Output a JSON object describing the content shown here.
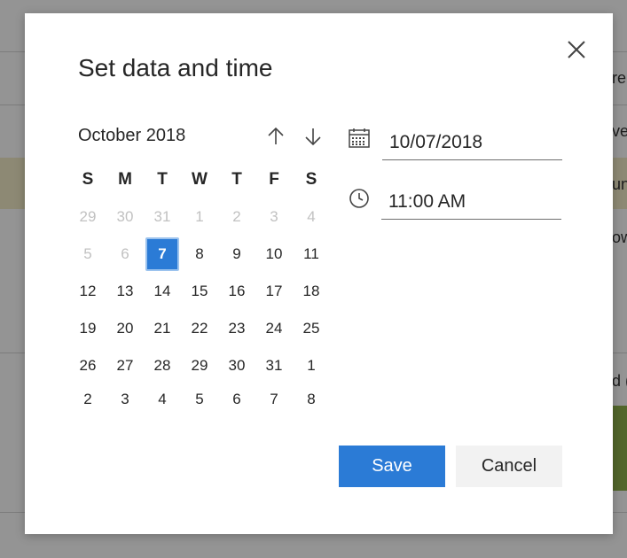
{
  "background": {
    "snippets": [
      "re,",
      "ve",
      "un",
      "ow",
      "d ("
    ]
  },
  "dialog": {
    "title": "Set data and time",
    "close_icon": "close-icon"
  },
  "calendar": {
    "month_label": "October 2018",
    "prev_icon": "arrow-up-icon",
    "next_icon": "arrow-down-icon",
    "weekdays": [
      "S",
      "M",
      "T",
      "W",
      "T",
      "F",
      "S"
    ],
    "weeks": [
      [
        {
          "d": "29",
          "muted": true
        },
        {
          "d": "30",
          "muted": true
        },
        {
          "d": "31",
          "muted": true
        },
        {
          "d": "1",
          "muted": true
        },
        {
          "d": "2",
          "muted": true
        },
        {
          "d": "3",
          "muted": true
        },
        {
          "d": "4",
          "muted": true
        }
      ],
      [
        {
          "d": "5",
          "muted": true
        },
        {
          "d": "6",
          "muted": true
        },
        {
          "d": "7",
          "selected": true
        },
        {
          "d": "8"
        },
        {
          "d": "9"
        },
        {
          "d": "10"
        },
        {
          "d": "11"
        }
      ],
      [
        {
          "d": "12"
        },
        {
          "d": "13"
        },
        {
          "d": "14"
        },
        {
          "d": "15"
        },
        {
          "d": "16"
        },
        {
          "d": "17"
        },
        {
          "d": "18"
        }
      ],
      [
        {
          "d": "19"
        },
        {
          "d": "20"
        },
        {
          "d": "21"
        },
        {
          "d": "22"
        },
        {
          "d": "23"
        },
        {
          "d": "24"
        },
        {
          "d": "25"
        }
      ],
      [
        {
          "d": "26"
        },
        {
          "d": "27"
        },
        {
          "d": "28"
        },
        {
          "d": "29"
        },
        {
          "d": "30"
        },
        {
          "d": "31"
        },
        {
          "d": "1"
        }
      ],
      [
        {
          "d": "2"
        },
        {
          "d": "3"
        },
        {
          "d": "4"
        },
        {
          "d": "5"
        },
        {
          "d": "6"
        },
        {
          "d": "7"
        },
        {
          "d": "8"
        }
      ]
    ],
    "selected_color": "#2b7bd6"
  },
  "date_field": {
    "icon": "calendar-icon",
    "value": "10/07/2018"
  },
  "time_field": {
    "icon": "clock-icon",
    "value": "11:00 AM"
  },
  "buttons": {
    "save_label": "Save",
    "cancel_label": "Cancel"
  },
  "colors": {
    "accent": "#2b7bd6",
    "cancel_bg": "#f2f2f2"
  }
}
